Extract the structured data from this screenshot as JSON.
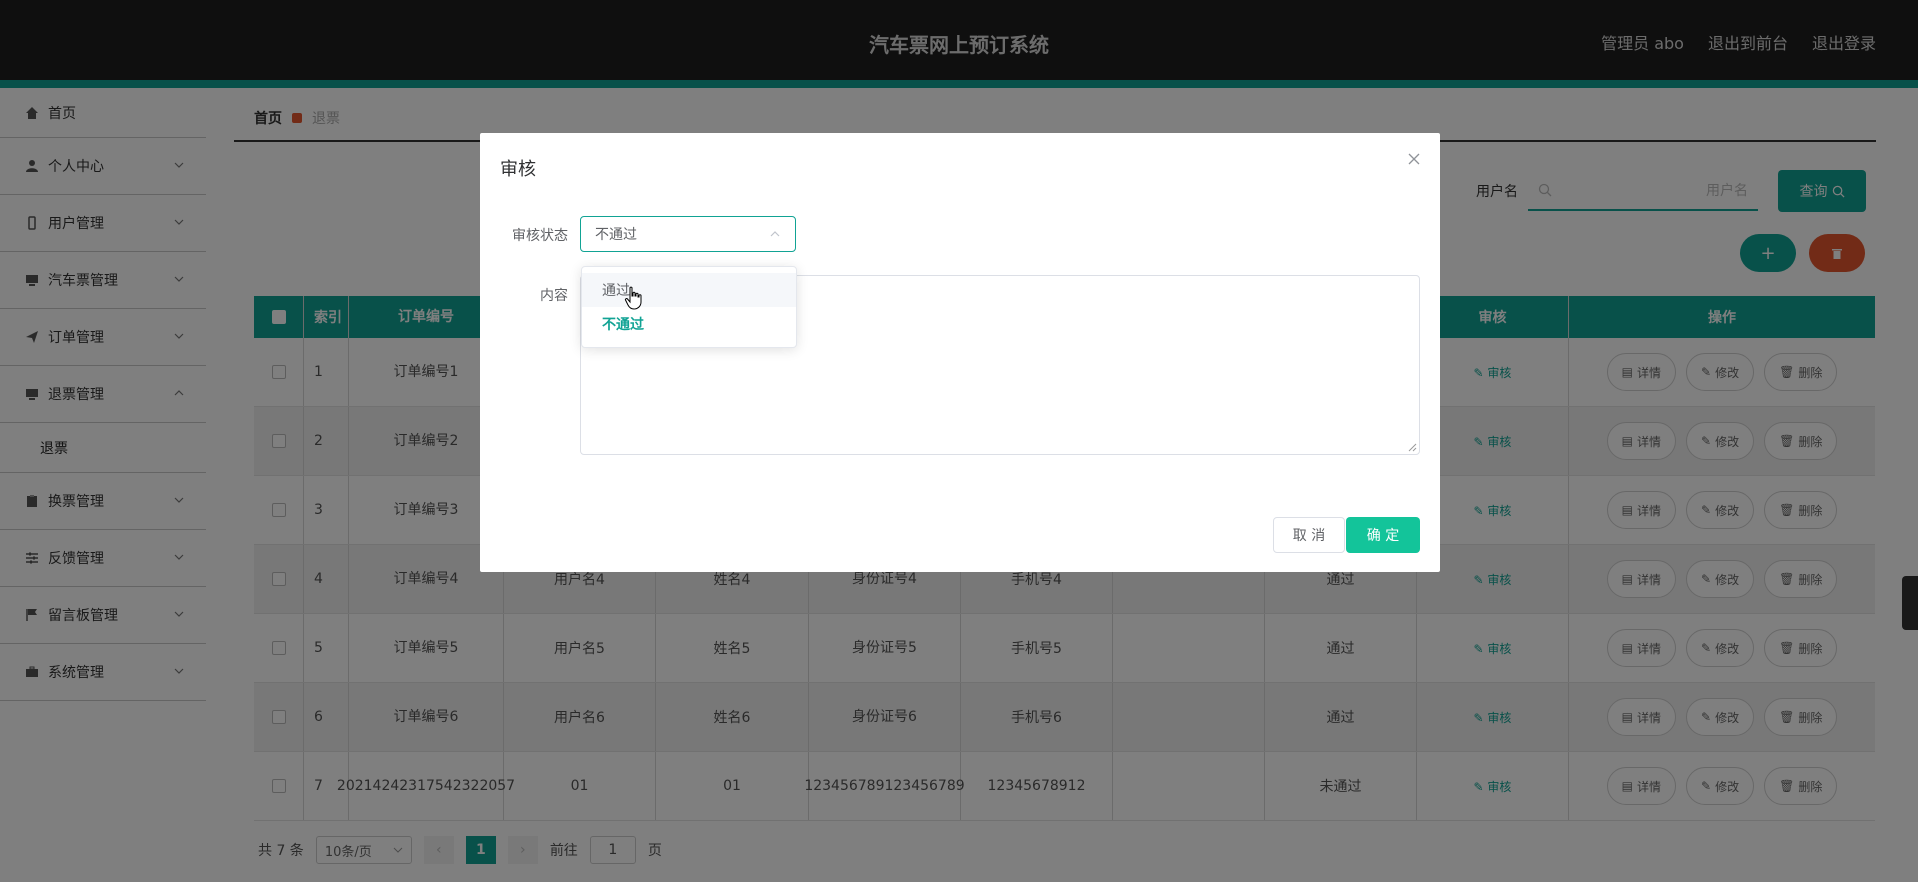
{
  "header": {
    "title": "汽车票网上预订系统",
    "user": "管理员 abo",
    "to_front": "退出到前台",
    "logout": "退出登录"
  },
  "sidebar": {
    "items": [
      {
        "label": "首页",
        "icon": "home-icon"
      },
      {
        "label": "个人中心",
        "icon": "user-icon"
      },
      {
        "label": "用户管理",
        "icon": "phone-icon"
      },
      {
        "label": "汽车票管理",
        "icon": "monitor-icon"
      },
      {
        "label": "订单管理",
        "icon": "send-icon"
      },
      {
        "label": "退票管理",
        "icon": "monitor-icon"
      },
      {
        "label": "换票管理",
        "icon": "clipboard-icon"
      },
      {
        "label": "反馈管理",
        "icon": "sliders-icon"
      },
      {
        "label": "留言板管理",
        "icon": "flag-icon"
      },
      {
        "label": "系统管理",
        "icon": "briefcase-icon"
      }
    ],
    "sub_item": "退票"
  },
  "breadcrumb": {
    "home": "首页",
    "current": "退票"
  },
  "search": {
    "label": "用户名",
    "placeholder": "用户名",
    "button": "查询"
  },
  "table": {
    "headers": {
      "index": "索引",
      "order": "订单编号",
      "audit": "审核",
      "ops": "操作"
    },
    "rows": [
      {
        "idx": "1",
        "order": "订单编号1",
        "user": "",
        "name": "",
        "idcard": "",
        "phone": "",
        "status": ""
      },
      {
        "idx": "2",
        "order": "订单编号2",
        "user": "",
        "name": "",
        "idcard": "",
        "phone": "",
        "status": ""
      },
      {
        "idx": "3",
        "order": "订单编号3",
        "user": "",
        "name": "",
        "idcard": "",
        "phone": "",
        "status": ""
      },
      {
        "idx": "4",
        "order": "订单编号4",
        "user": "用户名4",
        "name": "姓名4",
        "idcard": "身份证号4",
        "phone": "手机号4",
        "status": "通过"
      },
      {
        "idx": "5",
        "order": "订单编号5",
        "user": "用户名5",
        "name": "姓名5",
        "idcard": "身份证号5",
        "phone": "手机号5",
        "status": "通过"
      },
      {
        "idx": "6",
        "order": "订单编号6",
        "user": "用户名6",
        "name": "姓名6",
        "idcard": "身份证号6",
        "phone": "手机号6",
        "status": "通过"
      },
      {
        "idx": "7",
        "order": "20214242317542322057",
        "user": "01",
        "name": "01",
        "idcard": "123456789123456789",
        "phone": "12345678912",
        "status": "未通过"
      }
    ],
    "audit_label": "审核",
    "detail_label": "详情",
    "edit_label": "修改",
    "delete_label": "删除"
  },
  "pager": {
    "total": "共 7 条",
    "size": "10条/页",
    "page": "1",
    "goto": "前往",
    "goto_value": "1",
    "page_suffix": "页"
  },
  "dialog": {
    "title": "审核",
    "status_label": "审核状态",
    "status_value": "不通过",
    "content_label": "内容",
    "options": [
      "通过",
      "不通过"
    ],
    "cancel": "取 消",
    "ok": "确 定"
  },
  "colors": {
    "accent": "#11a394",
    "danger": "#e4572e",
    "header": "#1f1f1f"
  }
}
